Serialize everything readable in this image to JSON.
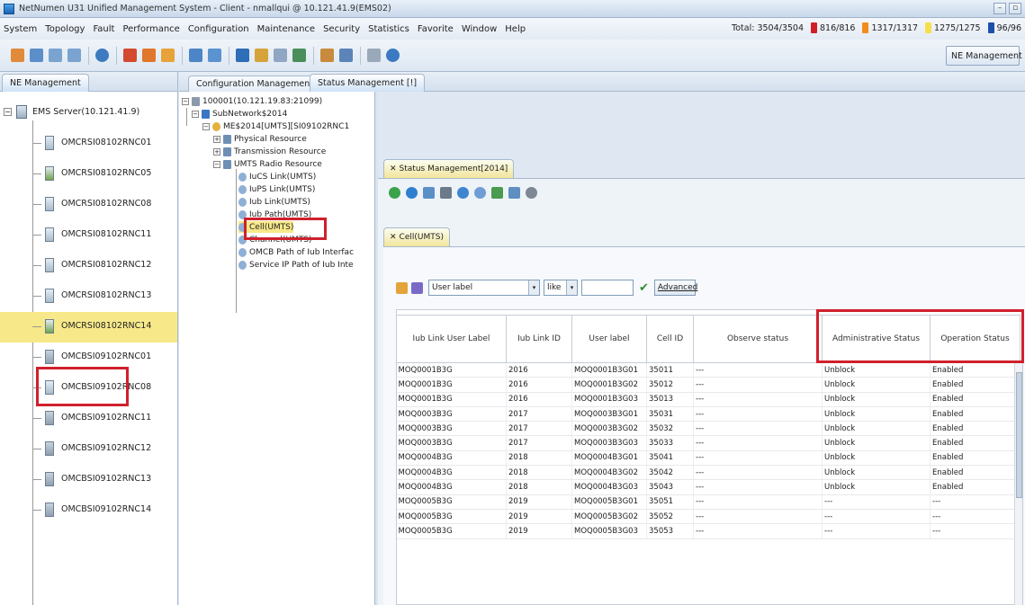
{
  "window": {
    "title": "NetNumen U31 Unified Management System - Client - nmallqui @ 10.121.41.9(EMS02)"
  },
  "menu": [
    "System",
    "Topology",
    "Fault",
    "Performance",
    "Configuration",
    "Maintenance",
    "Security",
    "Statistics",
    "Favorite",
    "Window",
    "Help"
  ],
  "totals": {
    "label": "Total:",
    "total": "3504/3504",
    "red": "816/816",
    "orange": "1317/1317",
    "yellow": "1275/1275",
    "blue": "96/96"
  },
  "toolbar": {
    "ne_management_label": "NE Management"
  },
  "left_panel": {
    "tab": "NE Management",
    "root": "EMS Server(10.121.41.9)",
    "items": [
      "OMCRSI08102RNC01",
      "OMCRSI08102RNC05",
      "OMCRSI08102RNC08",
      "OMCRSI08102RNC11",
      "OMCRSI08102RNC12",
      "OMCRSI08102RNC13",
      "OMCRSI08102RNC14",
      "OMCBSI09102RNC01",
      "OMCBSI09102RNC08",
      "OMCBSI09102RNC11",
      "OMCBSI09102RNC12",
      "OMCBSI09102RNC13",
      "OMCBSI09102RNC14"
    ]
  },
  "tabs": {
    "config": "Configuration Management",
    "status": "Status Management [!]"
  },
  "mid_tree": {
    "root": "100001(10.121.19.83:21099)",
    "subnetwork": "SubNetwork$2014",
    "me": "ME$2014[UMTS][SI09102RNC1",
    "physical": "Physical Resource",
    "transmission": "Transmission Resource",
    "umts": "UMTS Radio Resource",
    "iucs": "IuCS Link(UMTS)",
    "iups": "IuPS Link(UMTS)",
    "iub": "Iub Link(UMTS)",
    "iubpath": "Iub Path(UMTS)",
    "cell": "Cell(UMTS)",
    "channel": "Channel(UMTS)",
    "omcb": "OMCB Path of Iub Interfac",
    "serviceip": "Service IP Path of Iub Inte"
  },
  "status_tab": "Status Management[2014]",
  "cell_tab": "Cell(UMTS)",
  "filter": {
    "field": "User label",
    "op": "like",
    "value": "",
    "advanced": "Advanced"
  },
  "table": {
    "headers": [
      "Iub Link User Label",
      "Iub Link ID",
      "User label",
      "Cell ID",
      "Observe status",
      "Administrative Status",
      "Operation Status"
    ],
    "rows": [
      [
        "MOQ0001B3G",
        "2016",
        "MOQ0001B3G01",
        "35011",
        "---",
        "Unblock",
        "Enabled"
      ],
      [
        "MOQ0001B3G",
        "2016",
        "MOQ0001B3G02",
        "35012",
        "---",
        "Unblock",
        "Enabled"
      ],
      [
        "MOQ0001B3G",
        "2016",
        "MOQ0001B3G03",
        "35013",
        "---",
        "Unblock",
        "Enabled"
      ],
      [
        "MOQ0003B3G",
        "2017",
        "MOQ0003B3G01",
        "35031",
        "---",
        "Unblock",
        "Enabled"
      ],
      [
        "MOQ0003B3G",
        "2017",
        "MOQ0003B3G02",
        "35032",
        "---",
        "Unblock",
        "Enabled"
      ],
      [
        "MOQ0003B3G",
        "2017",
        "MOQ0003B3G03",
        "35033",
        "---",
        "Unblock",
        "Enabled"
      ],
      [
        "MOQ0004B3G",
        "2018",
        "MOQ0004B3G01",
        "35041",
        "---",
        "Unblock",
        "Enabled"
      ],
      [
        "MOQ0004B3G",
        "2018",
        "MOQ0004B3G02",
        "35042",
        "---",
        "Unblock",
        "Enabled"
      ],
      [
        "MOQ0004B3G",
        "2018",
        "MOQ0004B3G03",
        "35043",
        "---",
        "Unblock",
        "Enabled"
      ],
      [
        "MOQ0005B3G",
        "2019",
        "MOQ0005B3G01",
        "35051",
        "---",
        "---",
        "---"
      ],
      [
        "MOQ0005B3G",
        "2019",
        "MOQ0005B3G02",
        "35052",
        "---",
        "---",
        "---"
      ],
      [
        "MOQ0005B3G",
        "2019",
        "MOQ0005B3G03",
        "35053",
        "---",
        "---",
        "---"
      ]
    ]
  }
}
